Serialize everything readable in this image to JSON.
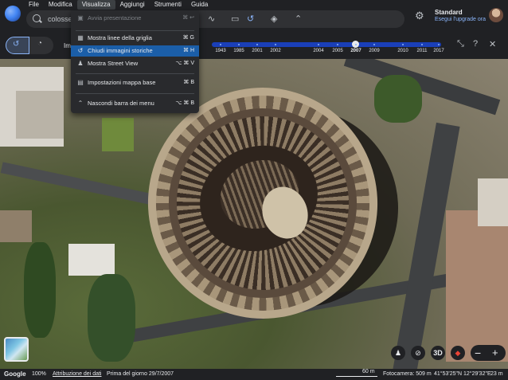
{
  "menu": [
    "File",
    "Modifica",
    "Visualizza",
    "Aggiungi",
    "Strumenti",
    "Guida"
  ],
  "search": {
    "value": "colosse"
  },
  "profile": {
    "plan": "Standard",
    "upgrade_link": "Esegui l'upgrade ora"
  },
  "history": {
    "label": "Imm"
  },
  "timeline": {
    "years": [
      "1943",
      "1985",
      "2001",
      "2002",
      "2004",
      "2005",
      "2007",
      "2009",
      "2010",
      "2011",
      "2017"
    ],
    "selected_year": "2007"
  },
  "dropdown": {
    "items": [
      {
        "icon": "presentation-icon",
        "glyph": "▣",
        "label": "Avvia presentazione",
        "shortcut": "⌘ ↩",
        "disabled": true
      },
      {
        "icon": "grid-icon",
        "glyph": "▦",
        "label": "Mostra linee della griglia",
        "shortcut": "⌘ G",
        "disabled": false
      },
      {
        "icon": "history-icon",
        "glyph": "↺",
        "label": "Chiudi immagini storiche",
        "shortcut": "⌘ H",
        "disabled": false,
        "highlight": true
      },
      {
        "icon": "pegman-icon",
        "glyph": "♟",
        "label": "Mostra Street View",
        "shortcut": "⌥ ⌘ V",
        "disabled": false
      },
      {
        "icon": "map-style-icon",
        "glyph": "▤",
        "label": "Impostazioni mappa base",
        "shortcut": "⌘ B",
        "disabled": false
      },
      {
        "icon": "chevron-up-icon",
        "glyph": "⌃",
        "label": "Nascondi barra dei menu",
        "shortcut": "⌥ ⌘ B",
        "disabled": false
      }
    ]
  },
  "map_controls": {
    "view_3d": "3D"
  },
  "status": {
    "brand": "Google",
    "zoom": "100%",
    "attribution": "Attribuzione dei dati",
    "imagery_date": "Prima del giorno 29/7/2007",
    "scale": "60 m",
    "camera": "Fotocamera: 509 m",
    "coords": "41°53'25\"N 12°29'32\"E",
    "altitude": "23 m"
  },
  "colors": {
    "accent": "#8ab4f8",
    "timeline": "#1a3fb8",
    "highlight": "#1b5ea8"
  }
}
